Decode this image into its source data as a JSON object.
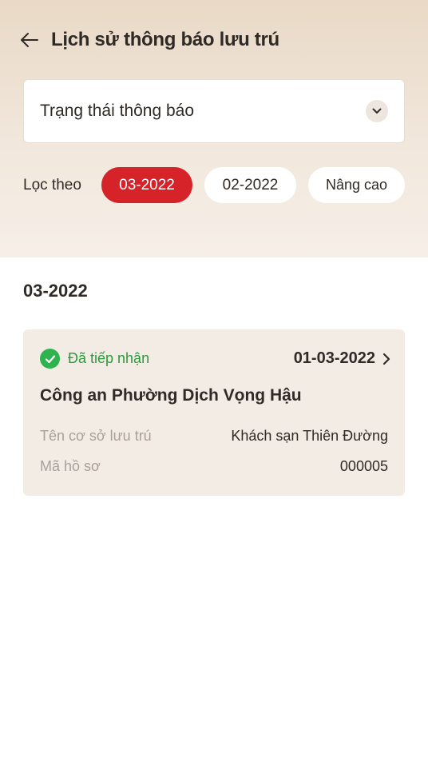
{
  "header": {
    "title": "Lịch sử thông báo lưu trú"
  },
  "status_select": {
    "label": "Trạng thái thông báo"
  },
  "filter": {
    "label": "Lọc theo",
    "chips": [
      {
        "label": "03-2022",
        "active": true
      },
      {
        "label": "02-2022",
        "active": false
      },
      {
        "label": "Nâng cao",
        "active": false
      }
    ]
  },
  "section": {
    "title": "03-2022"
  },
  "cards": [
    {
      "status": "Đã tiếp nhận",
      "date": "01-03-2022",
      "office": "Công an Phường Dịch Vọng Hậu",
      "rows": [
        {
          "label": "Tên cơ sở lưu trú",
          "value": "Khách sạn Thiên Đường"
        },
        {
          "label": "Mã hồ sơ",
          "value": "000005"
        }
      ]
    }
  ],
  "colors": {
    "accent": "#d6232a",
    "success": "#2fb34f",
    "card_bg": "#f3ece4"
  },
  "icons": {
    "back": "arrow-left-icon",
    "select": "chevron-down-icon",
    "status": "check-circle-icon",
    "open": "chevron-right-icon"
  }
}
